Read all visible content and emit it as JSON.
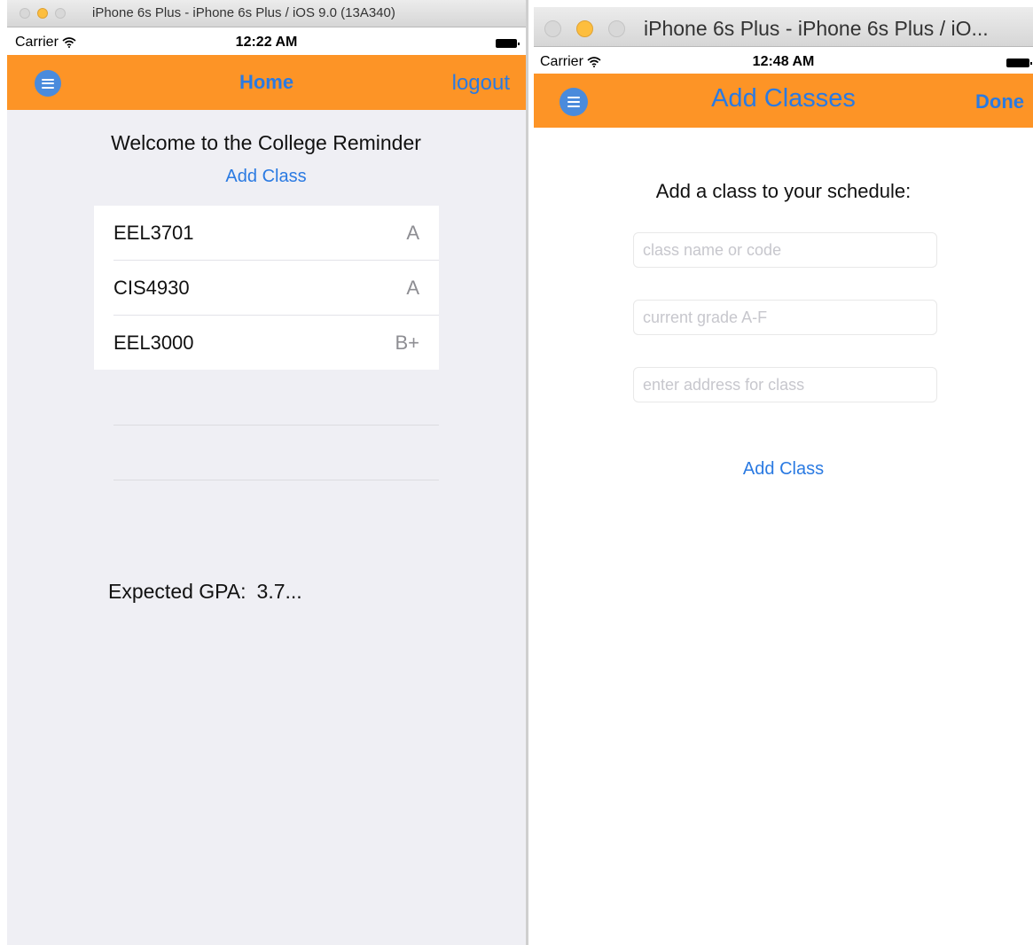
{
  "colors": {
    "navbar": "#fd9426",
    "accent": "#2a7ae2",
    "menu_icon": "#4a8bdc",
    "background_left": "#efeff4"
  },
  "left_window": {
    "title": "iPhone 6s Plus - iPhone 6s Plus / iOS 9.0 (13A340)",
    "status": {
      "carrier": "Carrier",
      "wifi_icon": "wifi-icon",
      "time": "12:22 AM",
      "battery_icon": "battery-icon"
    },
    "nav": {
      "menu_icon": "menu-icon",
      "title": "Home",
      "right_button": "logout"
    },
    "welcome": "Welcome to the College Reminder",
    "add_class_link": "Add Class",
    "classes": [
      {
        "name": "EEL3701",
        "grade": "A"
      },
      {
        "name": "CIS4930",
        "grade": "A"
      },
      {
        "name": "EEL3000",
        "grade": "B+"
      }
    ],
    "gpa": {
      "label": "Expected GPA:",
      "value": "3.7..."
    }
  },
  "right_window": {
    "title": "iPhone 6s Plus - iPhone 6s Plus / iO...",
    "status": {
      "carrier": "Carrier",
      "wifi_icon": "wifi-icon",
      "time": "12:48 AM",
      "battery_icon": "battery-icon"
    },
    "nav": {
      "menu_icon": "menu-icon",
      "title": "Add Classes",
      "right_button": "Done"
    },
    "form_title": "Add a class to your schedule:",
    "fields": {
      "class_name_placeholder": "class name or code",
      "grade_placeholder": "current grade A-F",
      "address_placeholder": "enter address for class"
    },
    "add_button": "Add Class"
  }
}
